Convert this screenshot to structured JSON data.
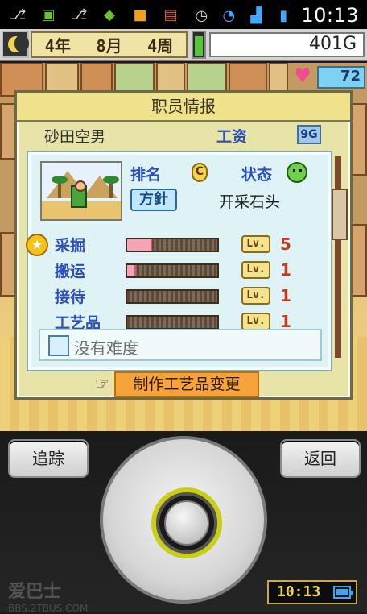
{
  "status_bar": {
    "time": "10:13",
    "icons": [
      "usb-icon",
      "android-icon",
      "usb-icon",
      "game-app-icon",
      "app-icon",
      "app-icon",
      "alarm-icon",
      "wifi-icon",
      "signal-icon",
      "battery-icon"
    ]
  },
  "top_bar": {
    "date_year": "4年",
    "date_month": "8月",
    "date_week": "4周",
    "money": "401G",
    "heart_count": "72"
  },
  "panel": {
    "title": "职员情报",
    "employee_name": "砂田空男",
    "pay_label": "工资",
    "pay_value": "9G",
    "rank_label": "排名",
    "rank_value": "C",
    "status_label": "状态",
    "policy_button": "方針",
    "policy_text": "开采石头",
    "skills": [
      {
        "name": "采掘",
        "level": "5",
        "progress": 0.28
      },
      {
        "name": "搬运",
        "level": "1",
        "progress": 0.1
      },
      {
        "name": "接待",
        "level": "1",
        "progress": 0.0
      },
      {
        "name": "工艺品",
        "level": "1",
        "progress": 0.0
      }
    ],
    "difficulty_text": "没有难度",
    "change_button": "制作工艺品变更"
  },
  "controls": {
    "track_button": "追踪",
    "back_button": "返回",
    "watermark": "爱巴士",
    "watermark_small": "BBS.2TBUS.COM",
    "clock": "10:13"
  },
  "colors": {
    "accent_blue": "#2a4fb8",
    "bar_fill": "#f7a3b6",
    "orange_button": "#f7a33b",
    "gauge_green": "#59c43a"
  }
}
